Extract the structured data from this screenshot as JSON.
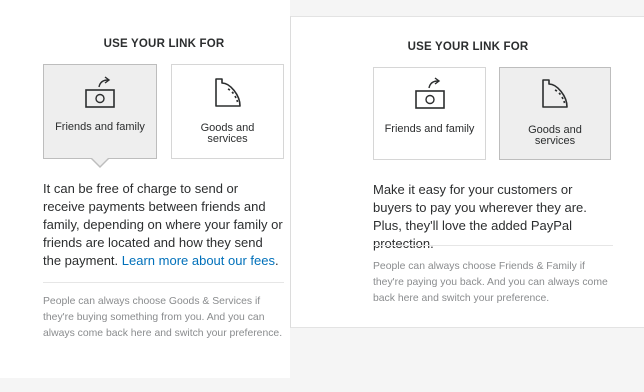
{
  "left": {
    "heading": "USE YOUR LINK FOR",
    "options": {
      "friends_label": "Friends and family",
      "goods_label_line1": "Goods and",
      "goods_label_line2": "services"
    },
    "selected": "friends",
    "description": "It can be free of charge to send or receive payments between friends and family, depending on where your family or friends are located and how they send the payment.",
    "link_text": "Learn more about our fees",
    "link_suffix": ".",
    "note": "People can always choose Goods & Services if they're buying something from you. And you can always come back here and switch your preference."
  },
  "right": {
    "heading": "USE YOUR LINK FOR",
    "options": {
      "friends_label": "Friends and family",
      "goods_label_line1": "Goods and",
      "goods_label_line2": "services"
    },
    "selected": "goods",
    "description": "Make it easy for your customers or buyers to pay you wherever they are. Plus, they'll love the added PayPal protection.",
    "note": "People can always choose Friends & Family if they're paying you back. And you can always come back here and switch your preference."
  },
  "colors": {
    "link": "#0070ba",
    "selected_card_bg": "#eeeeee",
    "note_text": "#8a8c8e"
  },
  "icons": {
    "friends": "money-send-icon",
    "goods": "receipt-icon"
  }
}
